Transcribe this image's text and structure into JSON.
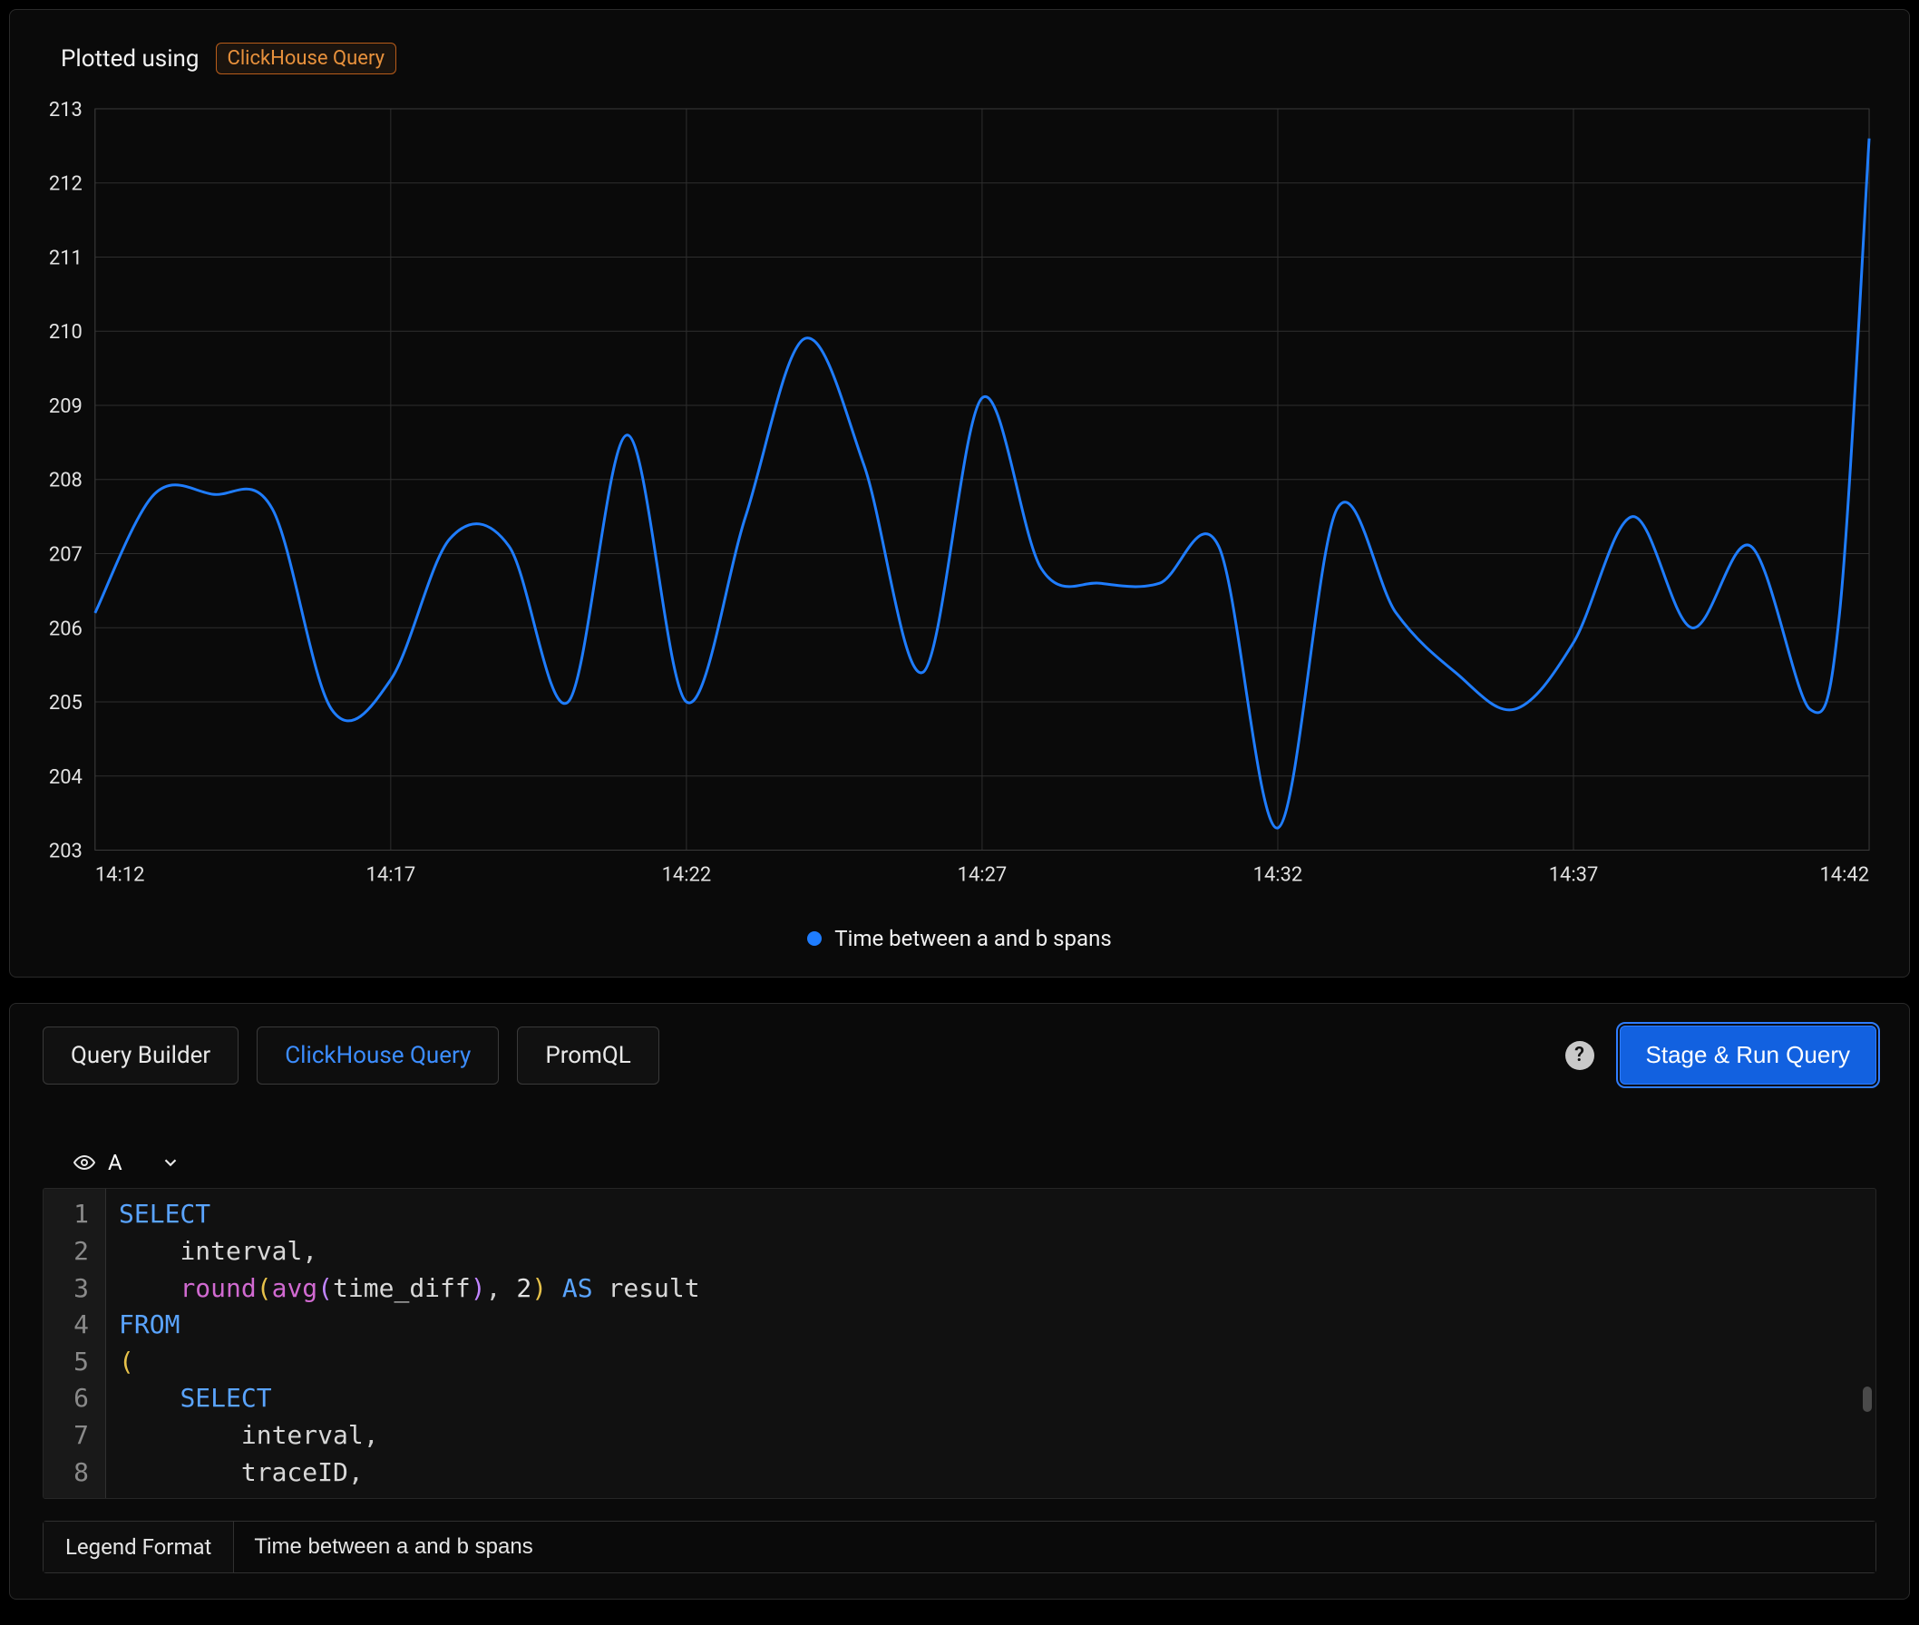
{
  "header": {
    "prefix": "Plotted using",
    "badge": "ClickHouse Query"
  },
  "chart_data": {
    "type": "line",
    "title": "",
    "xlabel": "",
    "ylabel": "",
    "legend": [
      "Time between a and b spans"
    ],
    "x_ticks": [
      "14:12",
      "14:17",
      "14:22",
      "14:27",
      "14:32",
      "14:37",
      "14:42"
    ],
    "y_ticks": [
      203,
      204,
      205,
      206,
      207,
      208,
      209,
      210,
      211,
      212,
      213
    ],
    "ylim": [
      203,
      213
    ],
    "series": [
      {
        "name": "Time between a and b spans",
        "color": "#1f7dff",
        "points": [
          {
            "x": "14:12",
            "y": 206.2
          },
          {
            "x": "14:13",
            "y": 207.8
          },
          {
            "x": "14:14",
            "y": 207.8
          },
          {
            "x": "14:15",
            "y": 207.6
          },
          {
            "x": "14:16",
            "y": 204.9
          },
          {
            "x": "14:17",
            "y": 205.3
          },
          {
            "x": "14:18",
            "y": 207.2
          },
          {
            "x": "14:19",
            "y": 207.1
          },
          {
            "x": "14:20",
            "y": 205.0
          },
          {
            "x": "14:21",
            "y": 208.6
          },
          {
            "x": "14:22",
            "y": 205.0
          },
          {
            "x": "14:23",
            "y": 207.5
          },
          {
            "x": "14:24",
            "y": 209.9
          },
          {
            "x": "14:25",
            "y": 208.2
          },
          {
            "x": "14:26",
            "y": 205.4
          },
          {
            "x": "14:27",
            "y": 209.1
          },
          {
            "x": "14:28",
            "y": 206.8
          },
          {
            "x": "14:29",
            "y": 206.6
          },
          {
            "x": "14:30",
            "y": 206.6
          },
          {
            "x": "14:31",
            "y": 207.1
          },
          {
            "x": "14:32",
            "y": 203.3
          },
          {
            "x": "14:33",
            "y": 207.6
          },
          {
            "x": "14:34",
            "y": 206.2
          },
          {
            "x": "14:35",
            "y": 205.4
          },
          {
            "x": "14:36",
            "y": 204.9
          },
          {
            "x": "14:37",
            "y": 205.8
          },
          {
            "x": "14:38",
            "y": 207.5
          },
          {
            "x": "14:39",
            "y": 206.0
          },
          {
            "x": "14:40",
            "y": 207.1
          },
          {
            "x": "14:41",
            "y": 204.9
          },
          {
            "x": "14:41.5",
            "y": 206.2
          },
          {
            "x": "14:42",
            "y": 212.6
          }
        ]
      }
    ]
  },
  "tabs": [
    {
      "id": "query-builder",
      "label": "Query Builder",
      "active": false
    },
    {
      "id": "clickhouse-query",
      "label": "ClickHouse Query",
      "active": true
    },
    {
      "id": "promql",
      "label": "PromQL",
      "active": false
    }
  ],
  "actions": {
    "run_query": "Stage & Run Query"
  },
  "query": {
    "name": "A",
    "visible": true,
    "lines": [
      [
        [
          "kw",
          "SELECT"
        ]
      ],
      [
        [
          "plain",
          "    "
        ],
        [
          "id",
          "interval"
        ],
        [
          "punc",
          ","
        ]
      ],
      [
        [
          "plain",
          "    "
        ],
        [
          "func",
          "round"
        ],
        [
          "par",
          "("
        ],
        [
          "func",
          "avg"
        ],
        [
          "par2",
          "("
        ],
        [
          "id",
          "time_diff"
        ],
        [
          "par2",
          ")"
        ],
        [
          "punc",
          ", "
        ],
        [
          "num",
          "2"
        ],
        [
          "par",
          ")"
        ],
        [
          "plain",
          " "
        ],
        [
          "kw",
          "AS"
        ],
        [
          "plain",
          " "
        ],
        [
          "id",
          "result"
        ]
      ],
      [
        [
          "kw",
          "FROM"
        ]
      ],
      [
        [
          "par",
          "("
        ]
      ],
      [
        [
          "plain",
          "    "
        ],
        [
          "kw",
          "SELECT"
        ]
      ],
      [
        [
          "plain",
          "        "
        ],
        [
          "id",
          "interval"
        ],
        [
          "punc",
          ","
        ]
      ],
      [
        [
          "plain",
          "        "
        ],
        [
          "id",
          "traceID"
        ],
        [
          "punc",
          ","
        ]
      ]
    ]
  },
  "legend_format": {
    "label": "Legend Format",
    "value": "Time between a and b spans"
  }
}
